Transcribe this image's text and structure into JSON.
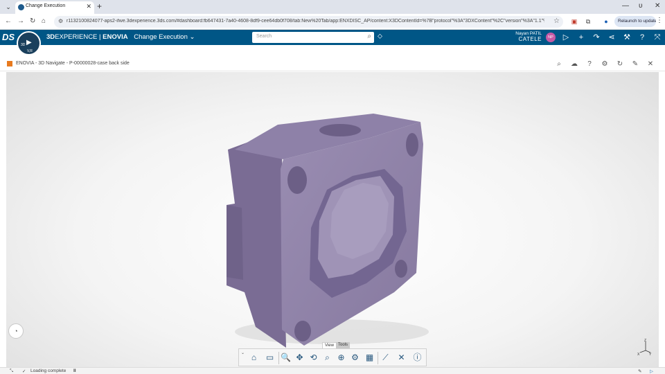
{
  "browser": {
    "tab_title": "Change Execution",
    "url": "r1132100824077-aps2-ifwe.3dexperience.3ds.com/#dashboard:fb647431-7a40-4608-8df9-cee64db0f708/tab:New%20Tab/app:ENXDISC_AP/content:X3DContentId=%7B\"protocol\"%3A\"3DXContent\"%2C\"version\"%3A\"1.1\"%2C\"...",
    "relaunch_label": "Relaunch to update",
    "new_tab_glyph": "+",
    "close_glyph": "✕",
    "minimize_glyph": "—",
    "restore_glyph": "ᴜ"
  },
  "app": {
    "brand_3d": "3D",
    "brand_experience": "EXPERIENCE",
    "brand_separator": " | ",
    "brand_app": "ENOVIA",
    "app_name": "Change Execution",
    "search_placeholder": "Search",
    "user_first": "Nayan PATIL",
    "user_second": "CATELE",
    "user_initials": "NP",
    "compass_v": "V,R",
    "compass_3d": "3D"
  },
  "widget": {
    "title": "ENOVIA - 3D Navigate - P-00000028-case back side"
  },
  "action_bar": {
    "tabs": [
      "View",
      "Tools"
    ],
    "active_tab": "View"
  },
  "axes": {
    "z": "Z",
    "x": "X",
    "y": "Y"
  },
  "status": {
    "message": "Loading complete",
    "pause_glyph": "II"
  },
  "colors": {
    "app_bar": "#005686",
    "model_face": "#8d7fa6",
    "model_side": "#7a6c94",
    "avatar": "#c55aa5"
  }
}
